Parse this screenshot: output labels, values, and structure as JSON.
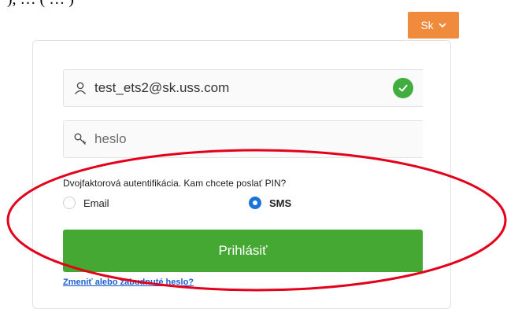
{
  "top_fragment": "”), … ( … )",
  "language": {
    "label": "Sk",
    "icon": "chevron-down-icon"
  },
  "login": {
    "email_value": "test_ets2@sk.uss.com",
    "email_icon": "user-icon",
    "email_status_icon": "check-circle-icon",
    "password_placeholder": "heslo",
    "password_icon": "key-icon"
  },
  "two_factor": {
    "question": "Dvojfaktorová autentifikácia. Kam chcete poslať PIN?",
    "options": [
      {
        "label": "Email",
        "selected": false
      },
      {
        "label": "SMS",
        "selected": true
      }
    ]
  },
  "submit_label": "Prihlásiť",
  "forgot_link": "Zmeniť alebo zabudnuté heslo?",
  "colors": {
    "accent_orange": "#f08a3c",
    "submit_green": "#45a832",
    "check_green": "#3fae3f",
    "radio_blue": "#1a73d8",
    "link_blue": "#1a5fd0",
    "annotation_red": "#e3001b"
  }
}
